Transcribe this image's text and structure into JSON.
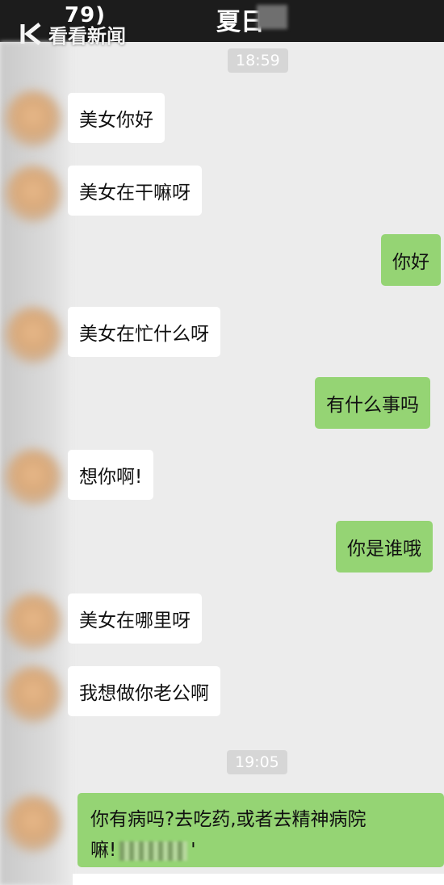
{
  "header": {
    "left_fragment": "79)",
    "contact_name": "夏日"
  },
  "watermark": {
    "text": "看看新闻"
  },
  "colors": {
    "header_bg": "#1c1c1c",
    "chat_bg": "#ececec",
    "sent_bubble": "#95d474",
    "received_bubble": "#ffffff"
  },
  "timestamps": [
    "18:59",
    "19:05"
  ],
  "messages": [
    {
      "side": "received",
      "text": "美女你好"
    },
    {
      "side": "received",
      "text": "美女在干嘛呀"
    },
    {
      "side": "sent",
      "text": "你好"
    },
    {
      "side": "received",
      "text": "美女在忙什么呀"
    },
    {
      "side": "sent",
      "text": "有什么事吗"
    },
    {
      "side": "received",
      "text": "想你啊!"
    },
    {
      "side": "sent",
      "text": "你是谁哦"
    },
    {
      "side": "received",
      "text": "美女在哪里呀"
    },
    {
      "side": "received",
      "text": "我想做你老公啊"
    },
    {
      "side": "sent",
      "text_line1": "你有病吗?去吃药,或者去精神病院",
      "text_line2_start": "嘛!",
      "text_line2_end": "'"
    }
  ]
}
